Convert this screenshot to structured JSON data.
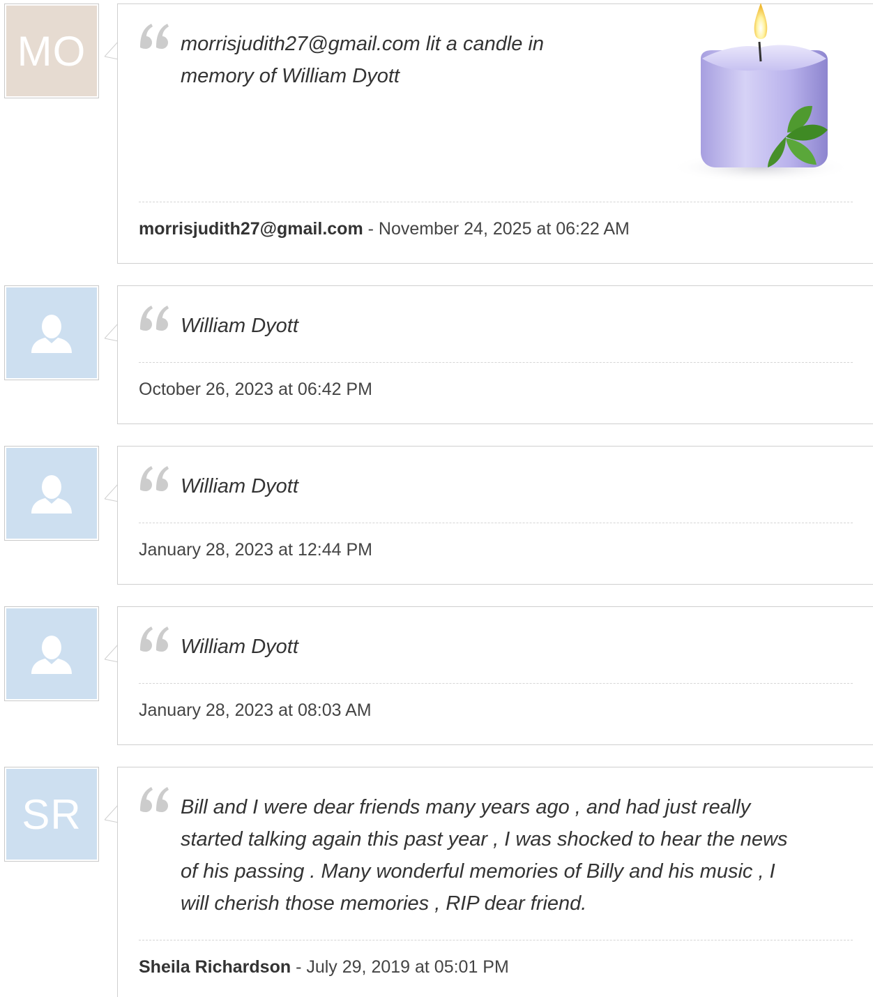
{
  "entries": [
    {
      "avatar_initials": "MO",
      "message_lines": [
        "morrisjudith27@gmail.com lit a candle in",
        "memory of William Dyott"
      ],
      "author": "morrisjudith27@gmail.com",
      "separator": " - ",
      "date": "November 24, 2025 at 06:22 AM",
      "image": "candle-image"
    },
    {
      "avatar_icon": "person-icon",
      "message_lines": [
        "William Dyott"
      ],
      "date": "October 26, 2023 at 06:42 PM"
    },
    {
      "avatar_icon": "person-icon",
      "message_lines": [
        "William Dyott"
      ],
      "date": "January 28, 2023 at 12:44 PM"
    },
    {
      "avatar_icon": "person-icon",
      "message_lines": [
        "William Dyott"
      ],
      "date": "January 28, 2023 at 08:03 AM"
    },
    {
      "avatar_initials": "SR",
      "message_lines": [
        "Bill and I were dear friends many years ago , and had just really",
        "started talking again this past year , I was shocked to hear the news",
        "of his passing . Many wonderful memories of Billy and his music , I",
        "will cherish those memories , RIP dear friend."
      ],
      "author": "Sheila Richardson",
      "separator": " - ",
      "date": "July 29, 2019 at 05:01 PM"
    }
  ],
  "colors": {
    "avatar_beige": "#e6dbd1",
    "avatar_blue": "#cddff0",
    "quote_mark": "#cccccc",
    "border": "#cfcfcf"
  }
}
